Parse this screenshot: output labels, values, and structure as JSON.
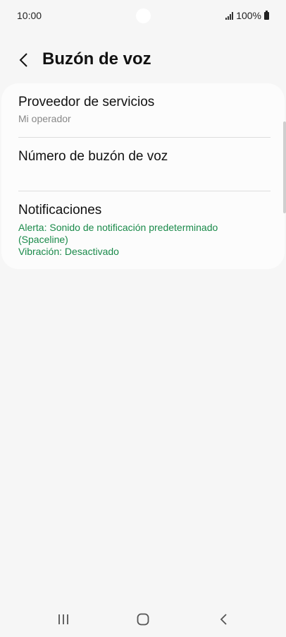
{
  "status_bar": {
    "time": "10:00",
    "battery": "100%"
  },
  "header": {
    "title": "Buzón de voz"
  },
  "settings": [
    {
      "title": "Proveedor de servicios",
      "subtitle": "Mi operador"
    },
    {
      "title": "Número de buzón de voz"
    },
    {
      "title": "Notificaciones",
      "line1": "Alerta: Sonido de notificación predeterminado",
      "line2": "(Spaceline)",
      "line3": "Vibración: Desactivado"
    }
  ],
  "colors": {
    "accent_green": "#1a8a4a",
    "background": "#f6f6f6",
    "card": "#fcfcfc"
  },
  "icons": {
    "back": "chevron-left-icon",
    "recents": "recents-icon",
    "home": "home-icon",
    "nav_back": "nav-back-icon"
  }
}
